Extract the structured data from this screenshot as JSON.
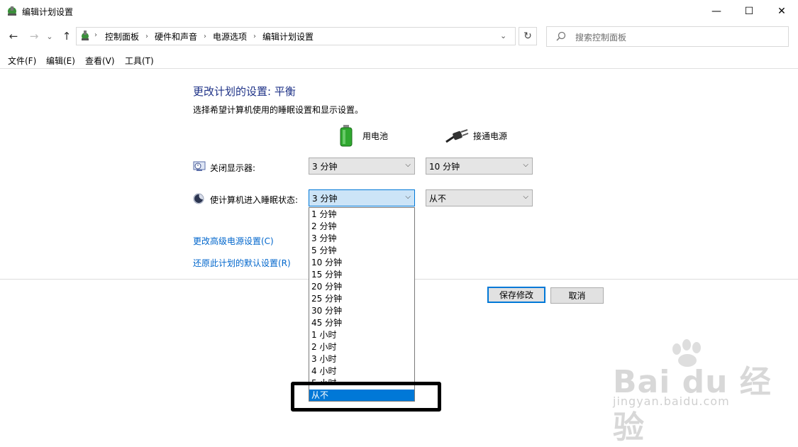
{
  "window": {
    "title": "编辑计划设置",
    "minimize_glyph": "—",
    "maximize_glyph": "☐",
    "close_glyph": "✕"
  },
  "navigation": {
    "back_glyph": "←",
    "forward_glyph": "→",
    "recent_glyph": "⌄",
    "up_glyph": "↑",
    "breadcrumbs": [
      "控制面板",
      "硬件和声音",
      "电源选项",
      "编辑计划设置"
    ],
    "search_placeholder": "搜索控制面板"
  },
  "menu": [
    "文件(F)",
    "编辑(E)",
    "查看(V)",
    "工具(T)"
  ],
  "content": {
    "heading": "更改计划的设置: 平衡",
    "subtext": "选择希望计算机使用的睡眠设置和显示设置。",
    "column_battery": "用电池",
    "column_plugged": "接通电源",
    "display_label": "关闭显示器:",
    "display_battery_value": "3 分钟",
    "display_plugged_value": "10 分钟",
    "sleep_label": "使计算机进入睡眠状态:",
    "sleep_battery_value": "3 分钟",
    "sleep_plugged_value": "从不",
    "advanced_link": "更改高级电源设置(C)",
    "restore_link": "还原此计划的默认设置(R)",
    "save_button": "保存修改",
    "cancel_button": "取消"
  },
  "dropdown_options": [
    "1 分钟",
    "2 分钟",
    "3 分钟",
    "5 分钟",
    "10 分钟",
    "15 分钟",
    "20 分钟",
    "25 分钟",
    "30 分钟",
    "45 分钟",
    "1 小时",
    "2 小时",
    "3 小时",
    "4 小时",
    "5 小时",
    "从不"
  ],
  "dropdown_selected": "从不",
  "watermark": {
    "main": "Bai du 经验",
    "sub": "jingyan.baidu.com"
  },
  "colors": {
    "heading": "#1e3287",
    "link": "#0066cc",
    "selection": "#0078d7"
  }
}
